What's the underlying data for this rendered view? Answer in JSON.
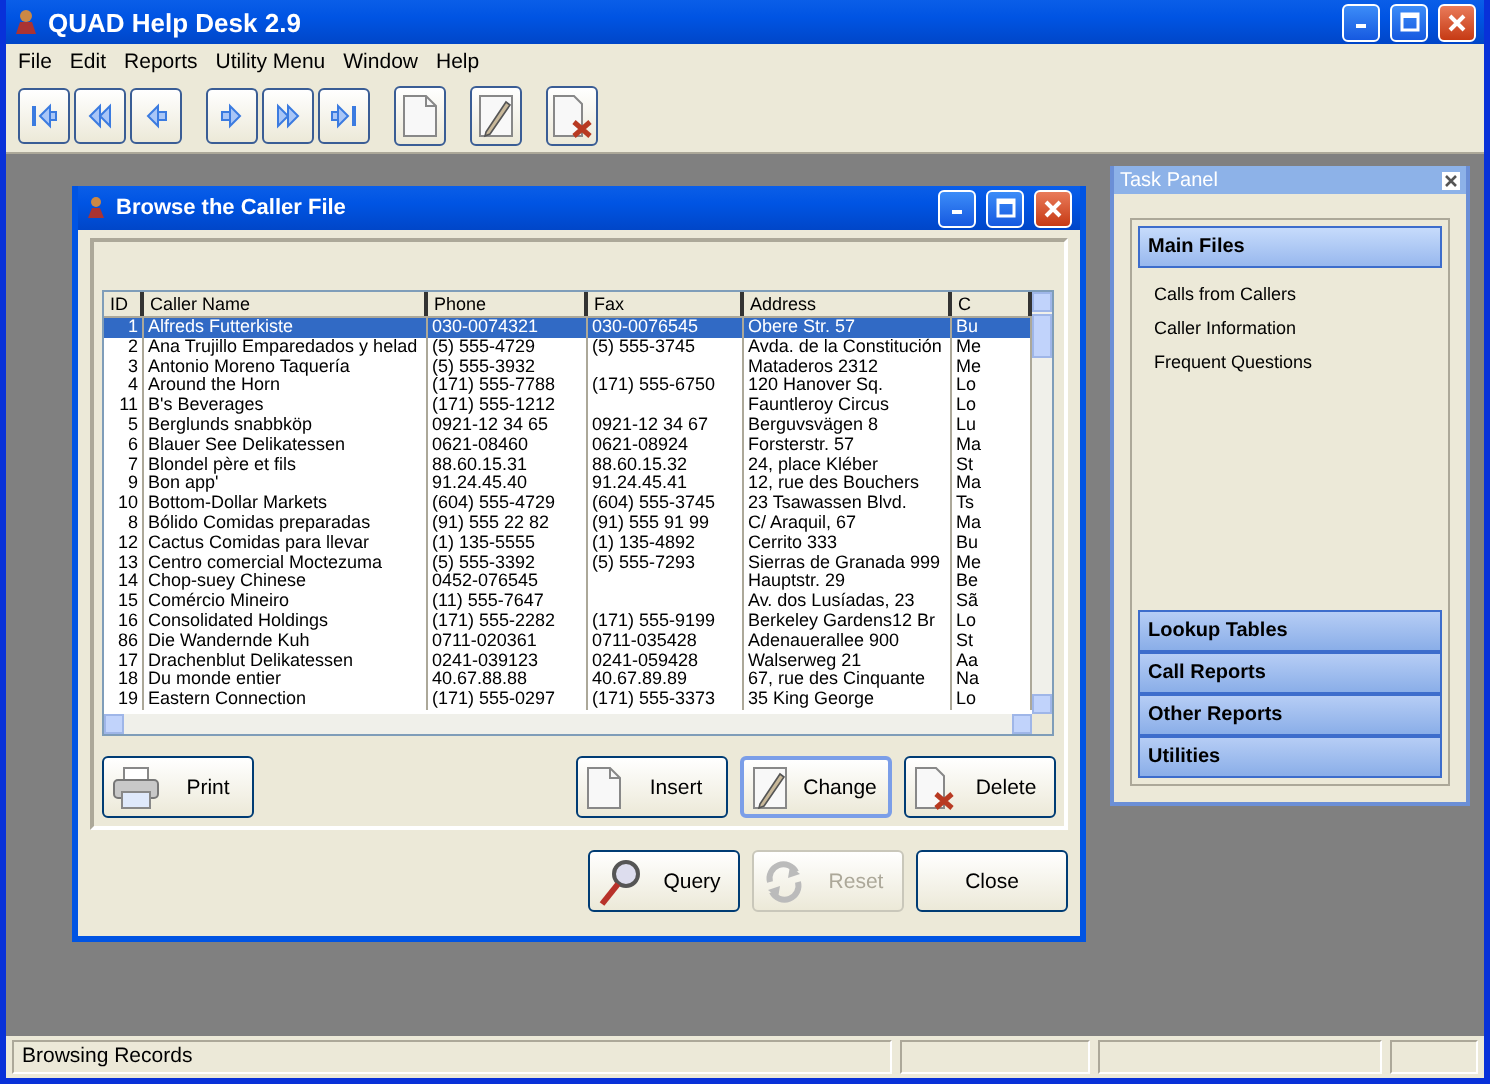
{
  "app": {
    "title": "QUAD Help Desk 2.9"
  },
  "menu": [
    "File",
    "Edit",
    "Reports",
    "Utility Menu",
    "Window",
    "Help"
  ],
  "toolbar": [
    {
      "kind": "first"
    },
    {
      "kind": "prev-page"
    },
    {
      "kind": "prev"
    },
    {
      "kind": "next"
    },
    {
      "kind": "next-page"
    },
    {
      "kind": "last"
    },
    {
      "kind": "new"
    },
    {
      "kind": "edit"
    },
    {
      "kind": "delete"
    }
  ],
  "browse": {
    "title": "Browse the Caller File",
    "table": {
      "columns": [
        "ID",
        "Caller Name",
        "Phone",
        "Fax",
        "Address",
        "C"
      ],
      "rows": [
        {
          "selected": true,
          "cells": [
            "1",
            "Alfreds Futterkiste",
            "030-0074321",
            "030-0076545",
            "Obere Str. 57",
            "Bu"
          ]
        },
        {
          "selected": false,
          "cells": [
            "2",
            "Ana Trujillo Emparedados y helad",
            "(5) 555-4729",
            "(5) 555-3745",
            "Avda. de la Constitución",
            "Me"
          ]
        },
        {
          "selected": false,
          "cells": [
            "3",
            "Antonio Moreno Taquería",
            "(5) 555-3932",
            "",
            "Mataderos  2312",
            "Me"
          ]
        },
        {
          "selected": false,
          "cells": [
            "4",
            "Around the Horn",
            "(171) 555-7788",
            "(171) 555-6750",
            "120 Hanover Sq.",
            "Lo"
          ]
        },
        {
          "selected": false,
          "cells": [
            "11",
            "B's Beverages",
            "(171) 555-1212",
            "",
            "Fauntleroy Circus",
            "Lo"
          ]
        },
        {
          "selected": false,
          "cells": [
            "5",
            "Berglunds snabbköp",
            "0921-12 34 65",
            "0921-12 34 67",
            "Berguvsvägen  8",
            "Lu"
          ]
        },
        {
          "selected": false,
          "cells": [
            "6",
            "Blauer See Delikatessen",
            "0621-08460",
            "0621-08924",
            "Forsterstr. 57",
            "Ma"
          ]
        },
        {
          "selected": false,
          "cells": [
            "7",
            "Blondel père et fils",
            "88.60.15.31",
            "88.60.15.32",
            "24, place Kléber",
            "St"
          ]
        },
        {
          "selected": false,
          "cells": [
            "9",
            "Bon app'",
            "91.24.45.40",
            "91.24.45.41",
            "12, rue des Bouchers",
            "Ma"
          ]
        },
        {
          "selected": false,
          "cells": [
            "10",
            "Bottom-Dollar Markets",
            "(604) 555-4729",
            "(604) 555-3745",
            "23 Tsawassen Blvd.",
            "Ts"
          ]
        },
        {
          "selected": false,
          "cells": [
            "8",
            "Bólido Comidas preparadas",
            "(91) 555 22 82",
            "(91) 555 91 99",
            "C/ Araquil, 67",
            "Ma"
          ]
        },
        {
          "selected": false,
          "cells": [
            "12",
            "Cactus Comidas para llevar",
            "(1) 135-5555",
            "(1) 135-4892",
            "Cerrito 333",
            "Bu"
          ]
        },
        {
          "selected": false,
          "cells": [
            "13",
            "Centro comercial Moctezuma",
            "(5) 555-3392",
            "(5) 555-7293",
            "Sierras de Granada 999",
            "Me"
          ]
        },
        {
          "selected": false,
          "cells": [
            "14",
            "Chop-suey Chinese",
            "0452-076545",
            "",
            "Hauptstr. 29",
            "Be"
          ]
        },
        {
          "selected": false,
          "cells": [
            "15",
            "Comércio Mineiro",
            "(11) 555-7647",
            "",
            "Av. dos Lusíadas, 23",
            "Sã"
          ]
        },
        {
          "selected": false,
          "cells": [
            "16",
            "Consolidated Holdings",
            "(171) 555-2282",
            "(171) 555-9199",
            "Berkeley Gardens12  Br",
            "Lo"
          ]
        },
        {
          "selected": false,
          "cells": [
            "86",
            "Die Wandernde Kuh",
            "0711-020361",
            "0711-035428",
            "Adenauerallee 900",
            "St"
          ]
        },
        {
          "selected": false,
          "cells": [
            "17",
            "Drachenblut Delikatessen",
            "0241-039123",
            "0241-059428",
            "Walserweg 21",
            "Aa"
          ]
        },
        {
          "selected": false,
          "cells": [
            "18",
            "Du monde entier",
            "40.67.88.88",
            "40.67.89.89",
            "67, rue des Cinquante",
            "Na"
          ]
        },
        {
          "selected": false,
          "cells": [
            "19",
            "Eastern Connection",
            "(171) 555-0297",
            "(171) 555-3373",
            "35 King George",
            "Lo"
          ]
        }
      ]
    },
    "panel_buttons": [
      {
        "label": "Print",
        "kind": "print",
        "focused": false,
        "disabled": false
      }
    ],
    "record_buttons": [
      {
        "label": "Insert",
        "kind": "new",
        "focused": false,
        "disabled": false
      },
      {
        "label": "Change",
        "kind": "edit",
        "focused": true,
        "disabled": false
      },
      {
        "label": "Delete",
        "kind": "delete",
        "focused": false,
        "disabled": false
      }
    ],
    "bottom_buttons": [
      {
        "label": "Query",
        "kind": "query",
        "focused": false,
        "disabled": false
      },
      {
        "label": "Reset",
        "kind": "reset",
        "focused": false,
        "disabled": true
      },
      {
        "label": "Close",
        "kind": "none",
        "focused": false,
        "disabled": false
      }
    ]
  },
  "task_panel": {
    "title": "Task Panel",
    "sections": [
      {
        "label": "Main Files",
        "expanded": true,
        "items": [
          "Calls from Callers",
          "Caller Information",
          "Frequent Questions"
        ]
      },
      {
        "label": "Lookup Tables",
        "expanded": false
      },
      {
        "label": "Call Reports",
        "expanded": false
      },
      {
        "label": "Other Reports",
        "expanded": false
      },
      {
        "label": "Utilities",
        "expanded": false
      }
    ]
  },
  "status_bar": {
    "text": "Browsing Records"
  }
}
